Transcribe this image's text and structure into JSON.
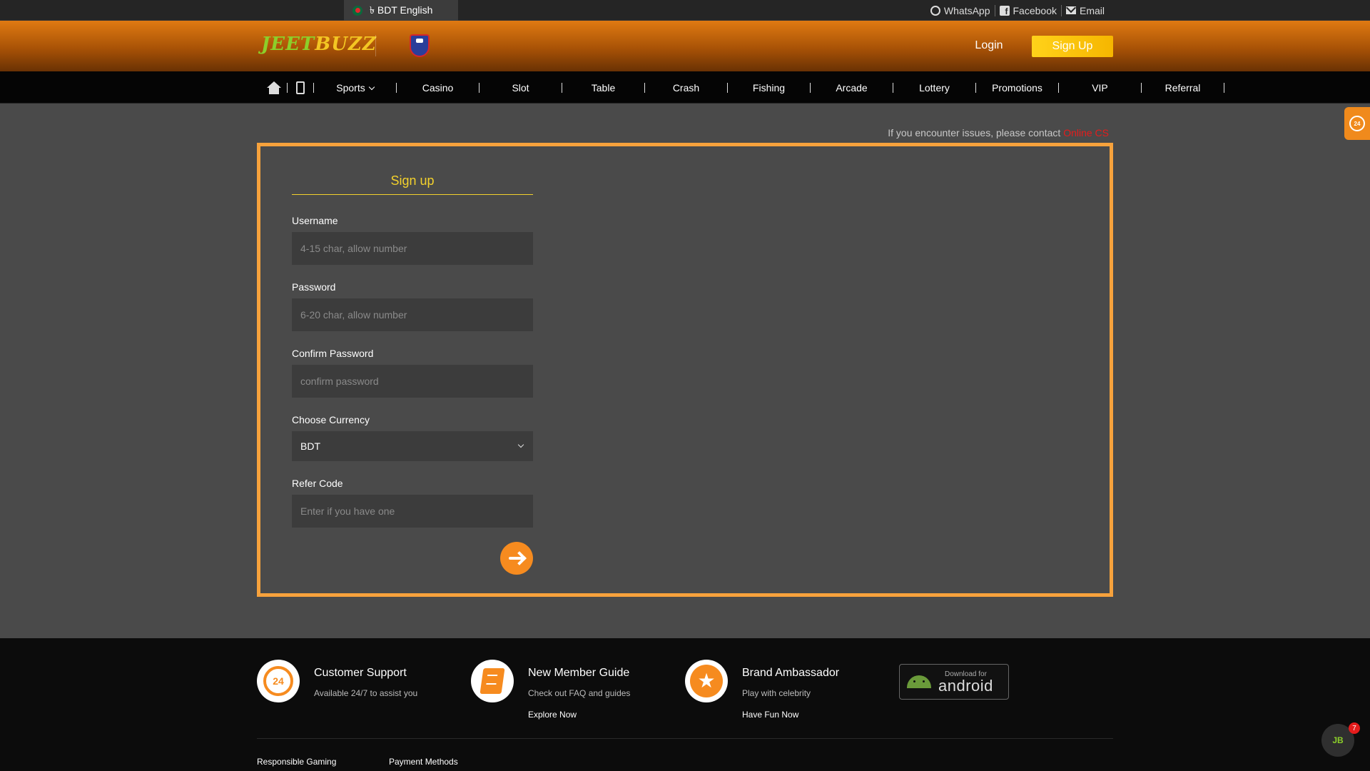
{
  "topbar": {
    "language": "৳ BDT English",
    "links": [
      {
        "label": "WhatsApp",
        "icon": "whatsapp-icon"
      },
      {
        "label": "Facebook",
        "icon": "facebook-icon"
      },
      {
        "label": "Email",
        "icon": "email-icon"
      }
    ]
  },
  "header": {
    "logo_left": "JEET",
    "logo_right": "BUZZ",
    "login_label": "Login",
    "signup_label": "Sign Up"
  },
  "nav": {
    "items": [
      "Sports",
      "Casino",
      "Slot",
      "Table",
      "Crash",
      "Fishing",
      "Arcade",
      "Lottery",
      "Promotions",
      "VIP",
      "Referral"
    ]
  },
  "notice": {
    "text": "If you encounter issues, please contact ",
    "link": "Online CS"
  },
  "form": {
    "title": "Sign up",
    "username_label": "Username",
    "username_placeholder": "4-15 char, allow number",
    "password_label": "Password",
    "password_placeholder": "6-20 char, allow number",
    "confirm_label": "Confirm Password",
    "confirm_placeholder": "confirm password",
    "currency_label": "Choose Currency",
    "currency_value": "BDT",
    "refer_label": "Refer Code",
    "refer_placeholder": "Enter if you have one"
  },
  "footer": {
    "features": [
      {
        "title": "Customer Support",
        "subtitle": "Available 24/7 to assist you",
        "link": ""
      },
      {
        "title": "New Member Guide",
        "subtitle": "Check out FAQ and guides",
        "link": "Explore Now"
      },
      {
        "title": "Brand Ambassador",
        "subtitle": "Play with celebrity",
        "link": "Have Fun Now"
      }
    ],
    "support_icon_text": "24",
    "android_small": "Download for",
    "android_big": "android",
    "bottom_links": [
      "Responsible Gaming",
      "Payment Methods"
    ]
  },
  "floating": {
    "support_tab_text": "24",
    "chat_badge": "7",
    "chat_logo": "JB"
  },
  "colors": {
    "accent_orange": "#f68b1f",
    "title_yellow": "#f3d12c",
    "form_border": "#f7a23c",
    "signup_button": "#ffd21a"
  }
}
